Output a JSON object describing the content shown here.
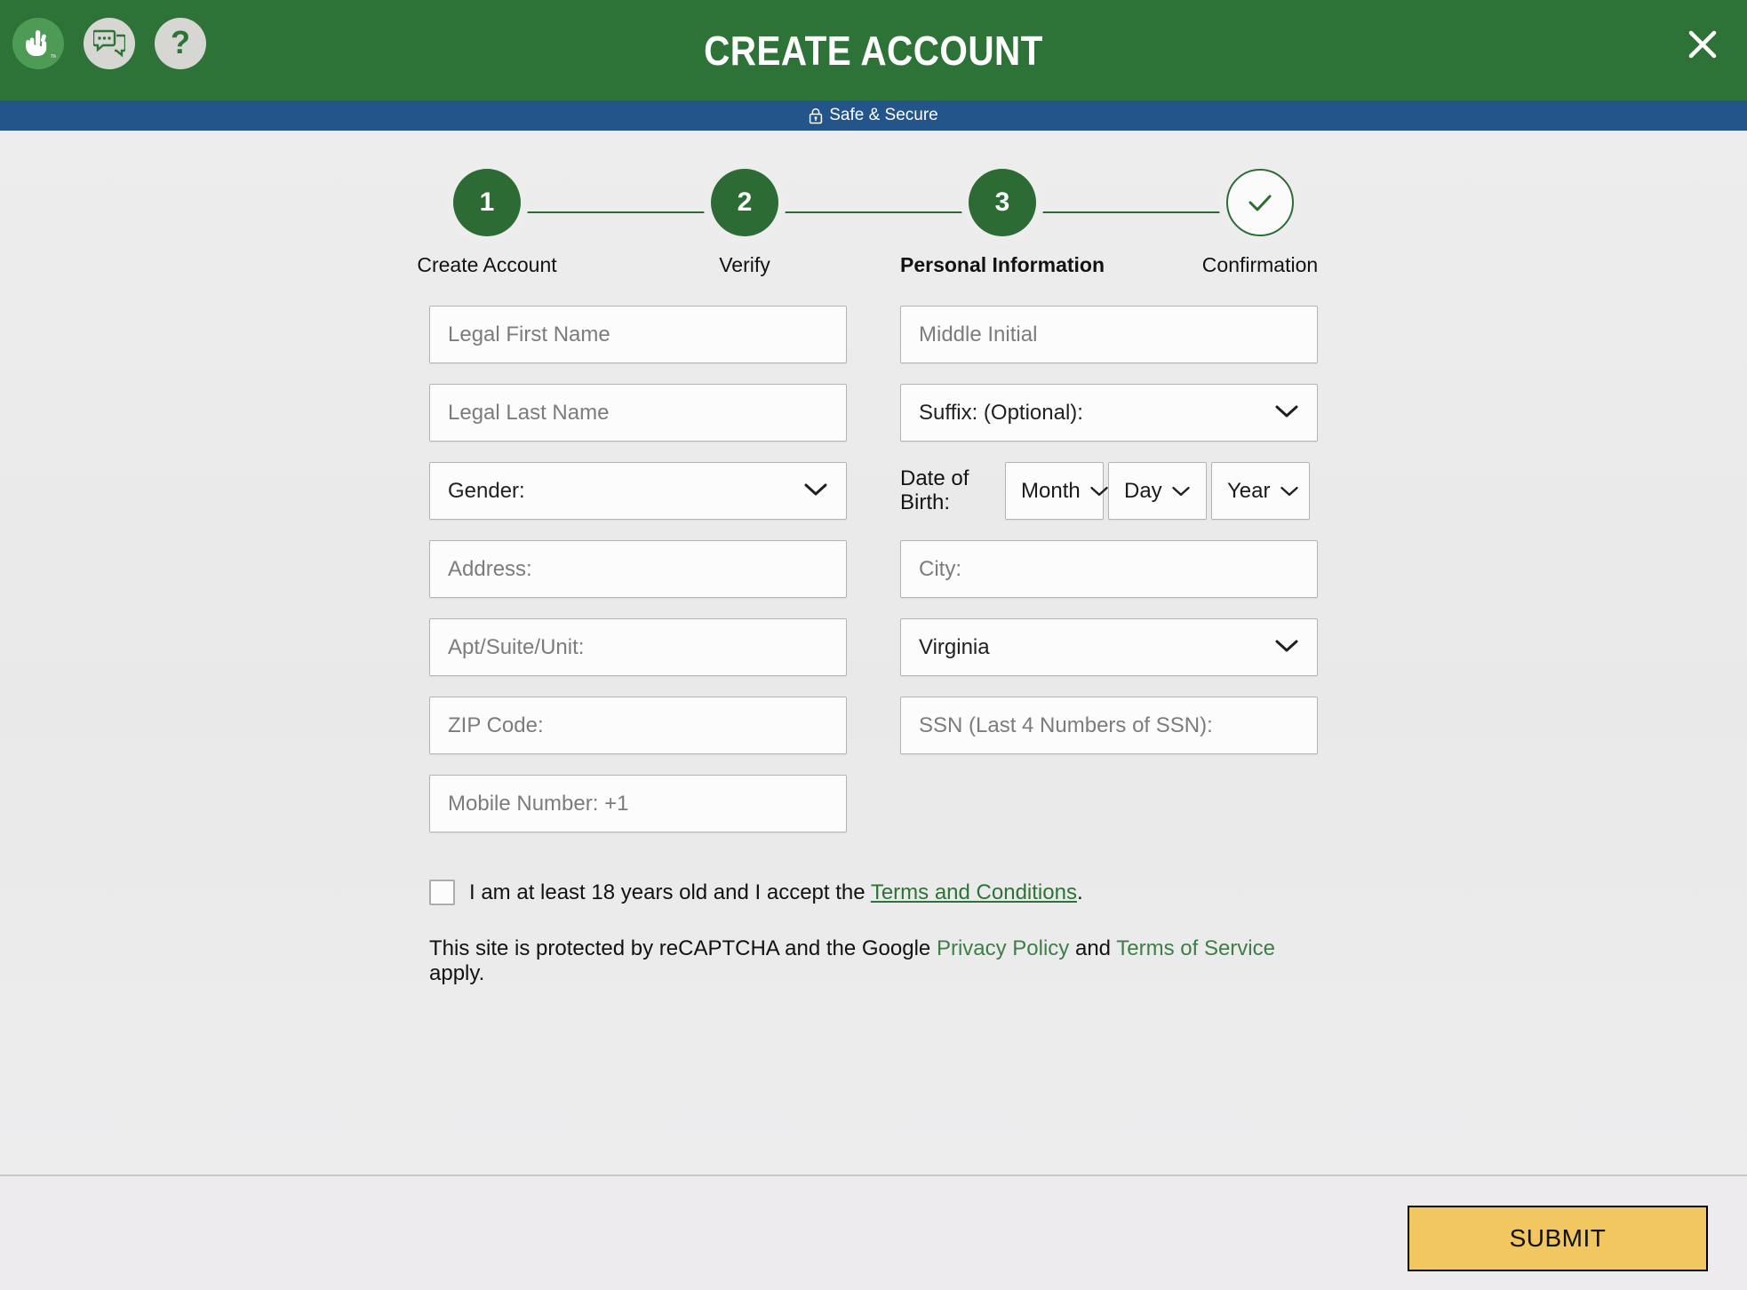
{
  "header": {
    "title": "CREATE ACCOUNT",
    "icons": [
      {
        "name": "asl-interpreter-icon",
        "label": "ASL Interpreter"
      },
      {
        "name": "chat-icon",
        "label": "Chat"
      },
      {
        "name": "help-icon",
        "label": "?"
      }
    ],
    "close_label": "✕",
    "bg_color": "#2D7338"
  },
  "secure_bar": {
    "text": "Safe & Secure",
    "icon": "lock-icon",
    "bg_color": "#23558B"
  },
  "stepper": {
    "steps": [
      {
        "number": "1",
        "label": "Create Account",
        "state": "complete",
        "active": false
      },
      {
        "number": "2",
        "label": "Verify",
        "state": "complete",
        "active": false
      },
      {
        "number": "3",
        "label": "Personal Information",
        "state": "current",
        "active": true
      },
      {
        "number": "✓",
        "label": "Confirmation",
        "state": "pending",
        "active": false
      }
    ],
    "accent_color": "#2D6B35"
  },
  "form": {
    "first_name": {
      "placeholder": "Legal First Name",
      "value": ""
    },
    "middle_initial": {
      "placeholder": "Middle Initial",
      "value": ""
    },
    "last_name": {
      "placeholder": "Legal Last Name",
      "value": ""
    },
    "suffix": {
      "label": "Suffix: (Optional):",
      "value": "Suffix: (Optional):"
    },
    "gender": {
      "label": "Gender:",
      "value": "Gender:"
    },
    "dob": {
      "label": "Date of Birth:",
      "label_line1": "Date of",
      "label_line2": "Birth:",
      "month": "Month",
      "day": "Day",
      "year": "Year"
    },
    "address": {
      "placeholder": "Address:",
      "value": ""
    },
    "city": {
      "placeholder": "City:",
      "value": ""
    },
    "apt": {
      "placeholder": "Apt/Suite/Unit:",
      "value": ""
    },
    "state": {
      "value": "Virginia"
    },
    "zip": {
      "placeholder": "ZIP Code:",
      "value": ""
    },
    "ssn": {
      "placeholder": "SSN (Last 4 Numbers of SSN):",
      "value": ""
    },
    "mobile": {
      "placeholder": "Mobile Number: +1",
      "value": ""
    }
  },
  "agreement": {
    "checked": false,
    "text_before": "I am at least 18 years old and I accept the ",
    "link_text": "Terms and Conditions",
    "text_after": "."
  },
  "recaptcha": {
    "part1": "This site is protected by reCAPTCHA and the Google ",
    "link1": "Privacy Policy",
    "part2": " and ",
    "link2": "Terms of Service",
    "part3": " apply."
  },
  "footer": {
    "submit_label": "SUBMIT",
    "submit_color": "#F2C75F"
  }
}
